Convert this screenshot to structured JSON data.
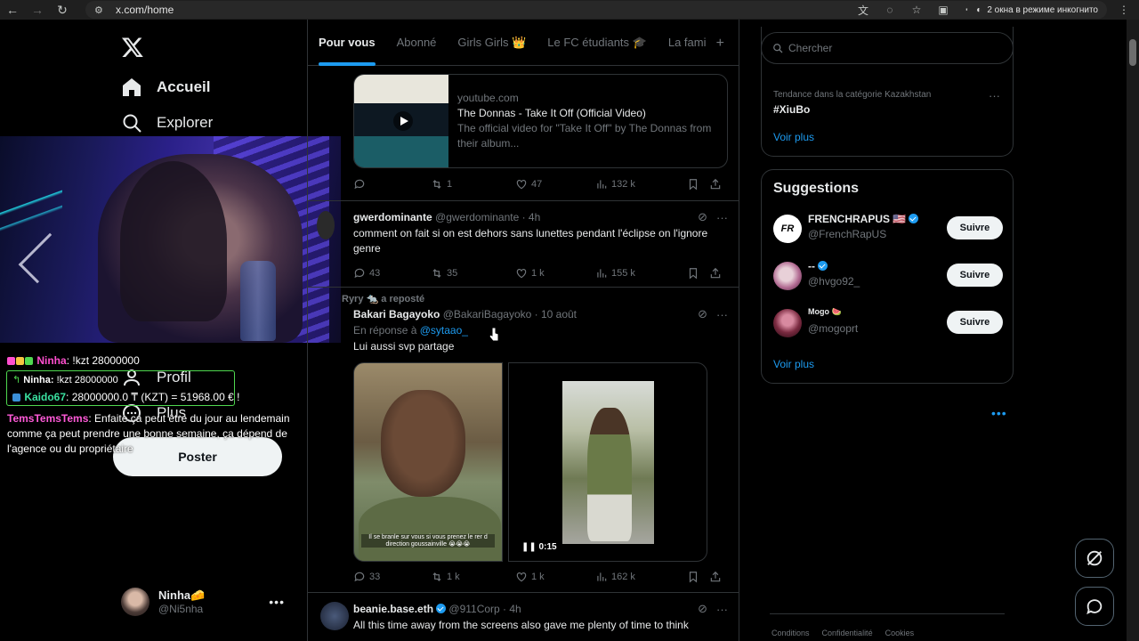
{
  "browser": {
    "url": "x.com/home",
    "incognito_label": "2 окна в режиме инкогнито"
  },
  "nav": {
    "home": "Accueil",
    "explore": "Explorer",
    "profile": "Profil",
    "more": "Plus",
    "post_button": "Poster",
    "account_name": "Ninha🧀",
    "account_handle": "@Ni5nha"
  },
  "chat": {
    "line1_user": "Ninha",
    "line1_text": ": !kzt 28000000",
    "reply_user": "Ninha:",
    "reply_text": "!kzt 28000000",
    "bot_user": "Kaido67",
    "bot_text": ": 28000000.0 ₸ (KZT) = 51968.00 € !",
    "tems_user": "TemsTemsTems",
    "tems_text": ": Enfaite ça peut être du jour au lendemain comme ça peut prendre une bonne semaine, ça dépend de l'agence ou du propriétaire"
  },
  "tabs": [
    "Pour vous",
    "Abonné",
    "Girls Girls 👑",
    "Le FC étudiants 🎓",
    "La fami"
  ],
  "posts": [
    {
      "card": {
        "domain": "youtube.com",
        "title": "The Donnas - Take It Off (Official Video)",
        "description": "The official video for \"Take It Off\" by The Donnas from their album..."
      },
      "stats": {
        "replies": "",
        "reposts": "1",
        "likes": "47",
        "views": "132 k"
      }
    },
    {
      "name": "gwerdominante",
      "handle": "@gwerdominante · 4h",
      "text": "comment on fait si on est dehors sans lunettes pendant l'éclipse on l'ignore genre",
      "stats": {
        "replies": "43",
        "reposts": "35",
        "likes": "1 k",
        "views": "155 k"
      }
    },
    {
      "reposted_by": "Ryry 🐀 a reposté",
      "name": "Bakari Bagayoko",
      "handle": "@BakariBagayoko · 10 août",
      "reply_to_label": "En réponse à",
      "reply_to": "@sytaao_",
      "text": "Lui aussi svp partage",
      "video_duration": "0:15",
      "subtitle": "Il se branle sur vous si vous prenez le rer d direction goussainville 😭😭😭",
      "stats": {
        "replies": "33",
        "reposts": "1 k",
        "likes": "1 k",
        "views": "162 k"
      }
    },
    {
      "name": "beanie.base.eth",
      "handle": "@911Corp · 4h",
      "text": "All this time away from the screens also gave me plenty of time to think"
    }
  ],
  "right": {
    "search_placeholder": "Chercher",
    "trend_category": "Tendance dans la catégorie Kazakhstan",
    "trend_tag": "#XiuBo",
    "see_more": "Voir plus",
    "suggestions_title": "Suggestions",
    "suggestions": [
      {
        "name": "FRENCHRAPUS 🇺🇸",
        "handle": "@FrenchRapUS",
        "button": "Suivre"
      },
      {
        "name": "--",
        "handle": "@hvgo92_",
        "button": "Suivre"
      },
      {
        "name": "Mogo 🍉",
        "handle": "@mogoprt",
        "button": "Suivre"
      }
    ],
    "see_more_2": "Voir plus",
    "footer": [
      "Conditions",
      "Confidentialité",
      "Cookies"
    ]
  },
  "colors": {
    "accent": "#1d9bf0",
    "background": "#000000",
    "border": "#2f3336",
    "muted": "#71767b"
  }
}
